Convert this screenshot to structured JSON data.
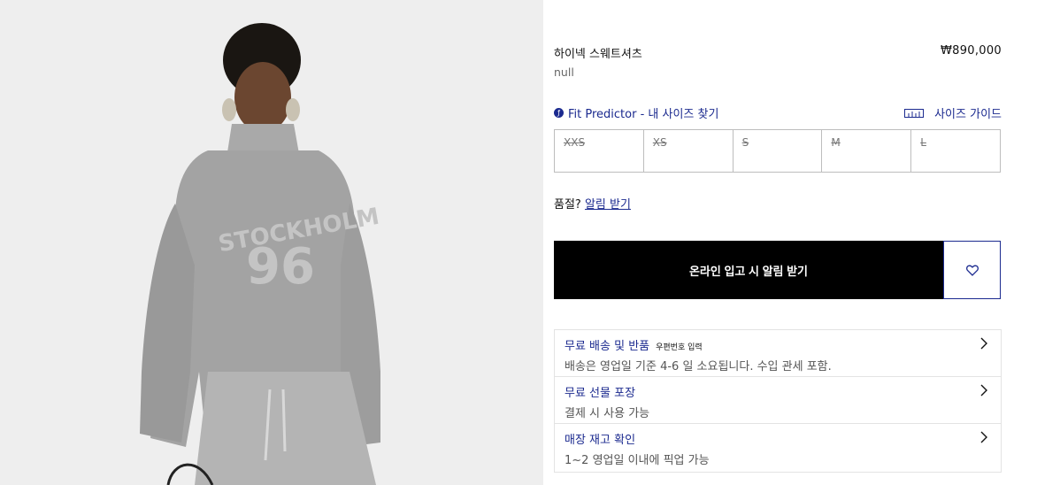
{
  "product": {
    "name": "하이넥 스웨트셔츠",
    "price": "₩890,000",
    "subtitle": "null"
  },
  "fit": {
    "predictor_label": "Fit Predictor - 내 사이즈 찾기",
    "predictor_icon": "fit-predictor-icon",
    "size_guide_label": "사이즈 가이드",
    "size_guide_icon": "ruler-icon"
  },
  "sizes": [
    "XXS",
    "XS",
    "S",
    "M",
    "L"
  ],
  "stock": {
    "soldout_text": "품절?",
    "notify_link": "알림 받기"
  },
  "actions": {
    "notify_button": "온라인 입고 시 알림 받기",
    "wishlist_icon": "heart-icon"
  },
  "info_sections": [
    {
      "title": "무료 배송 및 반품",
      "tag": "우편번호 입력",
      "desc": "배송은 영업일 기준 4-6 일 소요됩니다. 수입 관세 포함."
    },
    {
      "title": "무료 선물 포장",
      "tag": "",
      "desc": "결제 시 사용 가능"
    },
    {
      "title": "매장 재고 확인",
      "tag": "",
      "desc": "1~2 영업일 이내에 픽업 가능"
    }
  ],
  "image": {
    "print_text_1": "STOCKHOLM",
    "print_text_2": "96"
  },
  "colors": {
    "accent": "#1b2a8f",
    "button": "#000000",
    "image_bg": "#eeeeee"
  }
}
